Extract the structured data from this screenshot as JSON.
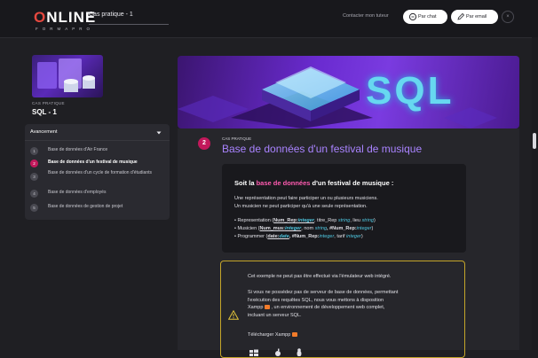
{
  "header": {
    "logo_main": "NLINE",
    "logo_o": "O",
    "logo_sub": "FORMAPRO",
    "course_title": "Cas pratique - 1",
    "contact_label": "Contacter mon tuteur",
    "chat_label": "Par chat",
    "email_label": "Par email",
    "close_label": "×"
  },
  "sidebar": {
    "case_label": "CAS PRATIQUE",
    "case_title": "SQL - 1",
    "progress_label": "Avancement",
    "steps": [
      {
        "num": "1",
        "label": "Base de données d'Air France"
      },
      {
        "num": "2",
        "label": "Base de données d'un festival de musique"
      },
      {
        "num": "3",
        "label": "Base de données d'un cycle de formation d'étudiants"
      },
      {
        "num": "4",
        "label": "Base de données d'employés"
      },
      {
        "num": "5",
        "label": "Base de données de gestion de projet"
      }
    ],
    "active_step": 2
  },
  "banner": {
    "text": "SQL"
  },
  "main": {
    "step_num": "2",
    "case_tag": "CAS PRATIQUE",
    "title": "Base de données d'un festival de musique",
    "card": {
      "title_pre": "Soit la ",
      "title_hl": "base de données",
      "title_post": " d'un festival de musique :",
      "para1": "Une représentation peut faire participer un ou plusieurs musiciens.",
      "para2": "Un musicien ne peut participer qu'à une seule représentation.",
      "items": [
        {
          "bullet": "• Representation (",
          "key": "Num_Rep:",
          "key_type": "integer",
          "rest_a": ", titre_Rep ",
          "type_a": "string",
          "rest_b": ", lieu ",
          "type_b": "string",
          "end": ")"
        },
        {
          "bullet": "• Musicien (",
          "key": "Num_mus:",
          "key_type": "integer",
          "rest_a": ", nom ",
          "type_a": "string",
          "rest_b": ", #Num_Rep:",
          "type_b": "integer",
          "end": ")"
        },
        {
          "bullet": "• Programmer (",
          "key": "date:",
          "key_type": "date",
          "rest_a": ", #Num_Rep:",
          "type_a": "integer",
          "rest_b": ", tarif ",
          "type_b": "integer",
          "end": ")"
        }
      ]
    },
    "warning": {
      "line1": "Cet exemple ne peut pas être effectué via l'émulateur web intégré.",
      "line2a": "Si vous ne possédez pas de serveur de base de données, permettant",
      "line2b": "l'exécution des requêtes SQL, nous vous mettons à disposition",
      "line2c_pre": "Xampp ",
      "line2c_post": " , un environnement de développement web complet,",
      "line2d": "incluant un serveur SQL.",
      "download_label": "Télécharger Xampp "
    }
  },
  "colors": {
    "accent": "#c2185b",
    "title": "#a983ff",
    "type": "#4fc7e0",
    "highlight": "#ff5bb0",
    "warning": "#c4a52a"
  }
}
